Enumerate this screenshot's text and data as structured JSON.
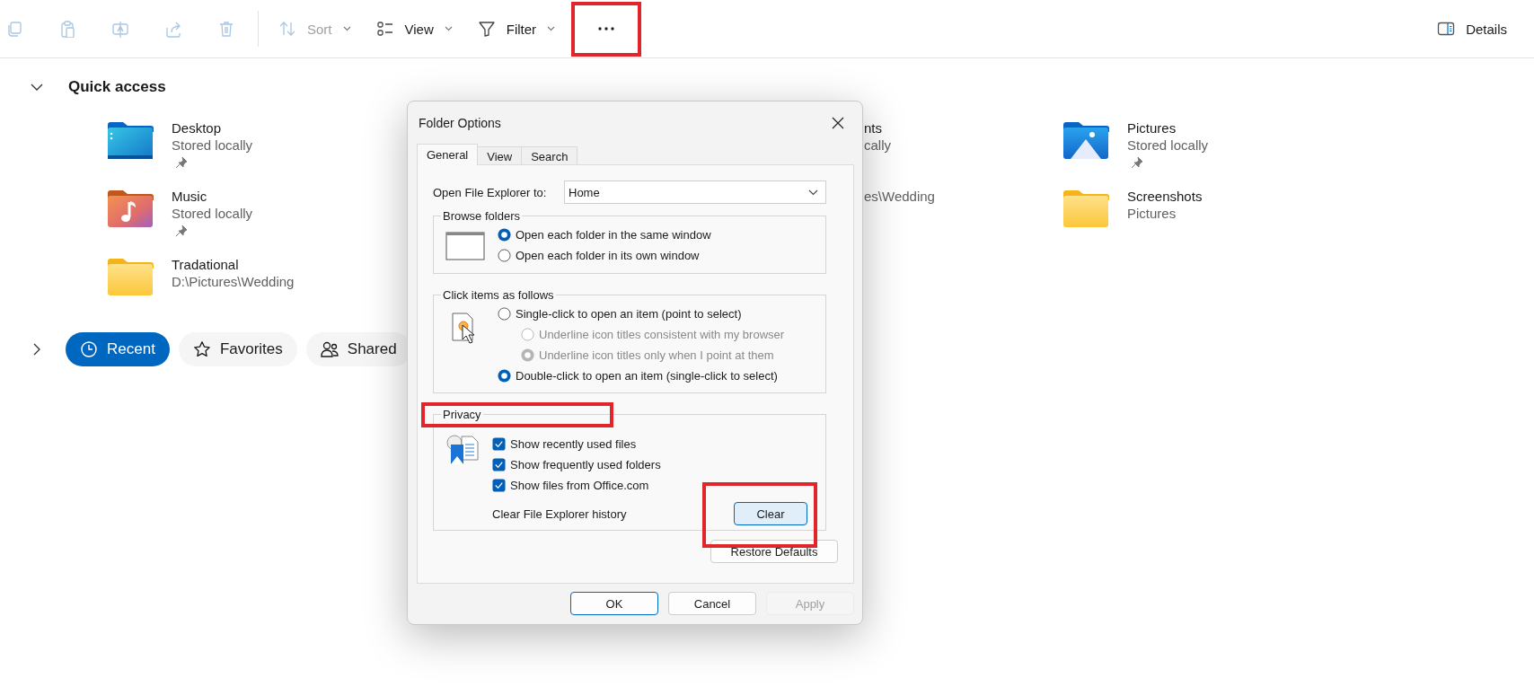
{
  "toolbar": {
    "actions": [
      {
        "kind": "copy",
        "disabled": true
      },
      {
        "kind": "paste",
        "disabled": true
      },
      {
        "kind": "rename",
        "disabled": true
      },
      {
        "kind": "share",
        "disabled": true
      },
      {
        "kind": "delete",
        "disabled": true
      }
    ],
    "sort": {
      "label": "Sort",
      "disabled": true
    },
    "view": {
      "label": "View",
      "disabled": false
    },
    "filter": {
      "label": "Filter",
      "disabled": false
    },
    "more": {
      "highlighted": true
    },
    "details": {
      "label": "Details"
    }
  },
  "quick_access": {
    "title": "Quick access",
    "expanded": true,
    "items": [
      {
        "kind": "desktop",
        "name": "Desktop",
        "detail": "Stored locally",
        "pinned": true
      },
      {
        "kind": "covered",
        "name": "nts",
        "detail": "cally"
      },
      {
        "kind": "pictures",
        "name": "Pictures",
        "detail": "Stored locally",
        "pinned": true
      },
      {
        "kind": "music",
        "name": "Music",
        "detail": "Stored locally",
        "pinned": true
      },
      {
        "kind": "covered",
        "detail": "es\\Wedding"
      },
      {
        "kind": "folder",
        "name": "Screenshots",
        "detail": "Pictures",
        "pinned": false
      },
      {
        "kind": "folder",
        "name": "Tradational",
        "detail": "D:\\Pictures\\Wedding",
        "pinned": false
      }
    ]
  },
  "recent_section": {
    "expanded": false,
    "tabs": [
      {
        "kind": "recent",
        "label": "Recent",
        "selected": true
      },
      {
        "kind": "favorites",
        "label": "Favorites",
        "selected": false
      },
      {
        "kind": "shared",
        "label": "Shared",
        "selected": false
      }
    ]
  },
  "dialog": {
    "title": "Folder Options",
    "tabs": [
      {
        "label": "General",
        "selected": true
      },
      {
        "label": "View",
        "selected": false
      },
      {
        "label": "Search",
        "selected": false
      }
    ],
    "open_to": {
      "label": "Open File Explorer to:",
      "value": "Home"
    },
    "browse_folders": {
      "title": "Browse folders",
      "options": [
        {
          "label": "Open each folder in the same window",
          "selected": true,
          "disabled": false
        },
        {
          "label": "Open each folder in its own window",
          "selected": false,
          "disabled": false
        }
      ]
    },
    "click_items": {
      "title": "Click items as follows",
      "options": [
        {
          "label": "Single-click to open an item (point to select)",
          "selected": false,
          "disabled": false,
          "children": [
            {
              "label": "Underline icon titles consistent with my browser",
              "selected": false,
              "disabled": true
            },
            {
              "label": "Underline icon titles only when I point at them",
              "selected": true,
              "disabled": true
            }
          ]
        },
        {
          "label": "Double-click to open an item (single-click to select)",
          "selected": true,
          "disabled": false
        }
      ]
    },
    "privacy": {
      "title": "Privacy",
      "highlighted": true,
      "checks": [
        {
          "label": "Show recently used files",
          "checked": true
        },
        {
          "label": "Show frequently used folders",
          "checked": true
        },
        {
          "label": "Show files from Office.com",
          "checked": true
        }
      ],
      "clear_label": "Clear File Explorer history",
      "clear_button": {
        "label": "Clear",
        "highlighted": true
      }
    },
    "restore_button": "Restore Defaults",
    "buttons": [
      {
        "kind": "default",
        "label": "OK",
        "disabled": false
      },
      {
        "kind": "normal",
        "label": "Cancel",
        "disabled": false
      },
      {
        "kind": "normal",
        "label": "Apply",
        "disabled": true
      }
    ]
  }
}
